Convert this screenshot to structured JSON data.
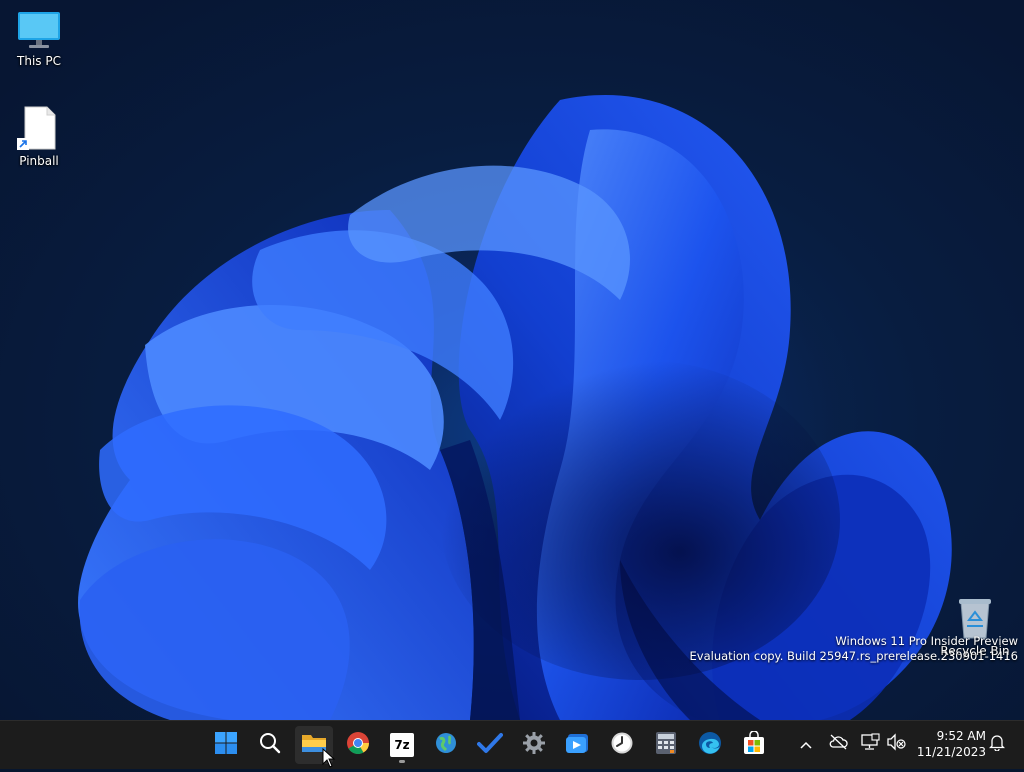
{
  "desktop": {
    "icons": [
      {
        "label": "This PC",
        "icon": "monitor-icon"
      },
      {
        "label": "Pinball",
        "icon": "file-shortcut-icon"
      },
      {
        "label": "Recycle Bin",
        "icon": "recycle-bin-icon"
      }
    ],
    "watermark": {
      "line1": "Windows 11 Pro Insider Preview",
      "line2": "Evaluation copy. Build 25947.rs_prerelease.230901-1416"
    }
  },
  "taskbar": {
    "apps": [
      {
        "name": "Start",
        "icon": "windows-start-icon"
      },
      {
        "name": "Search",
        "icon": "search-icon"
      },
      {
        "name": "File Explorer",
        "icon": "folder-icon",
        "active": true
      },
      {
        "name": "Google Chrome",
        "icon": "chrome-icon"
      },
      {
        "name": "7-Zip",
        "icon": "7zip-icon",
        "running": true
      },
      {
        "name": "Network tool",
        "icon": "globe-icon"
      },
      {
        "name": "Microsoft To Do",
        "icon": "checkmark-icon"
      },
      {
        "name": "Settings",
        "icon": "gear-icon"
      },
      {
        "name": "Media Player",
        "icon": "media-player-icon"
      },
      {
        "name": "Clock",
        "icon": "clock-icon"
      },
      {
        "name": "Calculator",
        "icon": "calculator-icon"
      },
      {
        "name": "Microsoft Edge",
        "icon": "edge-icon"
      },
      {
        "name": "Microsoft Store",
        "icon": "store-icon"
      }
    ],
    "seven_zip_label": "7z",
    "tray": {
      "icons": [
        "chevron-up-icon",
        "cloud-offline-icon",
        "network-icon",
        "volume-muted-icon"
      ],
      "time": "9:52 AM",
      "date": "11/21/2023",
      "notification_icon": "bell-icon"
    }
  },
  "colors": {
    "taskbar_bg": "#1c1c1c",
    "bloom_blue": "#1f4fe0",
    "bloom_light": "#4f8cff",
    "accent": "#0078d4"
  }
}
